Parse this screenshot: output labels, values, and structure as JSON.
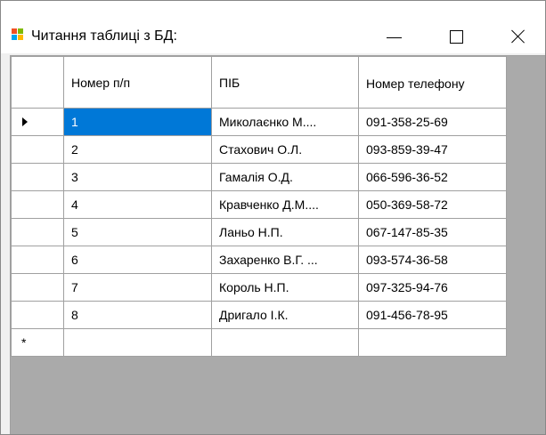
{
  "window": {
    "title": "Читання таблиці з БД:",
    "icon": "form-app-icon",
    "controls": {
      "minimize_icon": "minimize-icon",
      "maximize_icon": "maximize-icon",
      "close_icon": "close-icon"
    }
  },
  "grid": {
    "columns": [
      "Номер п/п",
      "ПІБ",
      "Номер телефону"
    ],
    "rows": [
      {
        "num": "1",
        "name": "Миколаєнко М....",
        "phone": "091-358-25-69"
      },
      {
        "num": "2",
        "name": "Стахович О.Л.",
        "phone": "093-859-39-47"
      },
      {
        "num": "3",
        "name": "Гамалія О.Д.",
        "phone": "066-596-36-52"
      },
      {
        "num": "4",
        "name": "Кравченко Д.М....",
        "phone": "050-369-58-72"
      },
      {
        "num": "5",
        "name": "Ланьо Н.П.",
        "phone": "067-147-85-35"
      },
      {
        "num": "6",
        "name": "Захаренко В.Г. ...",
        "phone": "093-574-36-58"
      },
      {
        "num": "7",
        "name": "Король Н.П.",
        "phone": "097-325-94-76"
      },
      {
        "num": "8",
        "name": "Дригало І.К.",
        "phone": "091-456-78-95"
      }
    ],
    "current_row_marker": "current-row-arrow-icon",
    "new_row_marker": "*",
    "selection_color": "#0078d7"
  }
}
